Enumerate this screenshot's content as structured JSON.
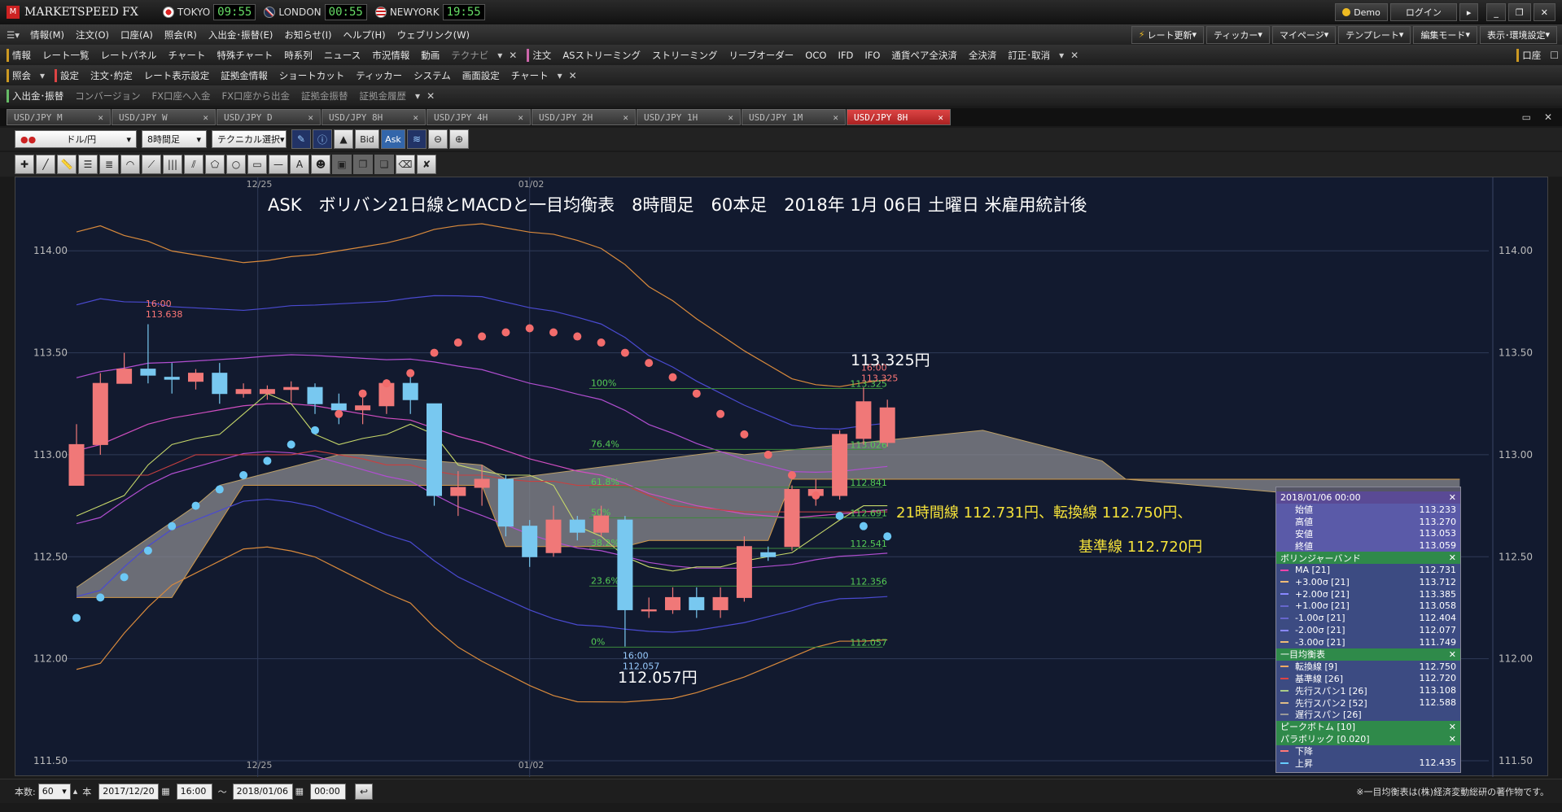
{
  "app": {
    "logo": "MARKETSPEED FX"
  },
  "clocks": [
    {
      "city": "TOKYO",
      "time": "09:55"
    },
    {
      "city": "LONDON",
      "time": "00:55"
    },
    {
      "city": "NEWYORK",
      "time": "19:55"
    }
  ],
  "titlebar": {
    "demo": "Demo",
    "login": "ログイン"
  },
  "menu": [
    "情報(M)",
    "注文(O)",
    "口座(A)",
    "照会(R)",
    "入出金･振替(E)",
    "お知らせ(I)",
    "ヘルプ(H)",
    "ウェブリンク(W)"
  ],
  "menu_right": [
    "レート更新",
    "ティッカー",
    "マイページ",
    "テンプレート",
    "編集モード",
    "表示･環境設定"
  ],
  "tb1": {
    "label1": "情報",
    "items1": [
      "レート一覧",
      "レートパネル",
      "チャート",
      "特殊チャート",
      "時系列",
      "ニュース",
      "市況情報",
      "動画",
      "テクナビ"
    ],
    "label2": "注文",
    "items2": [
      "ASストリーミング",
      "ストリーミング",
      "リーブオーダー",
      "OCO",
      "IFD",
      "IFO",
      "通貨ペア全決済",
      "全決済",
      "訂正･取消"
    ],
    "right": "口座"
  },
  "tb2": {
    "label1": "照会",
    "label2": "設定",
    "items": [
      "注文･約定",
      "レート表示設定",
      "証拠金情報",
      "ショートカット",
      "ティッカー",
      "システム",
      "画面設定",
      "チャート"
    ]
  },
  "tb3": {
    "label1": "入出金･振替",
    "items": [
      "コンバージョン",
      "FX口座へ入金",
      "FX口座から出金",
      "証拠金振替",
      "証拠金履歴"
    ]
  },
  "tabs": [
    "USD/JPY M",
    "USD/JPY W",
    "USD/JPY D",
    "USD/JPY 8H",
    "USD/JPY 4H",
    "USD/JPY 2H",
    "USD/JPY 1H",
    "USD/JPY 1M",
    "USD/JPY 8H"
  ],
  "controls": {
    "pair": "ドル/円",
    "period": "8時間足",
    "tech": "テクニカル選択",
    "bid": "Bid",
    "ask": "Ask"
  },
  "chart": {
    "title": "ASK　ボリバン21日線とMACDと一目均衡表　8時間足　60本足　2018年 1月 06日 土曜日 米雇用統計後",
    "high_label": "113.325円",
    "low_label": "112.057円",
    "note1": "21時間線 112.731円、転換線 112.750円、",
    "note2": "基準線 112.720円",
    "hi_marker": {
      "time": "16:00",
      "value": "113.638"
    },
    "hi2_marker": {
      "time": "16:00",
      "value": "113.325"
    },
    "lo_marker": {
      "time": "16:00",
      "value": "112.057"
    },
    "date_labels": [
      "12/25",
      "01/02"
    ],
    "fib": [
      {
        "label": "100%",
        "value": "113.325"
      },
      {
        "label": "76.4%",
        "value": "113.026"
      },
      {
        "label": "61.8%",
        "value": "112.841"
      },
      {
        "label": "50%",
        "value": "112.691"
      },
      {
        "label": "38.2%",
        "value": "112.541"
      },
      {
        "label": "23.6%",
        "value": "112.356"
      },
      {
        "label": "0%",
        "value": "112.057"
      }
    ]
  },
  "chart_data": {
    "type": "candlestick",
    "yticks": [
      "114.00",
      "113.50",
      "113.00",
      "112.50",
      "112.00",
      "111.50"
    ],
    "ylim": [
      111.42,
      114.36
    ],
    "candles": [
      [
        112.85,
        113.05,
        112.85,
        113.15
      ],
      [
        113.05,
        113.35,
        113.0,
        113.4
      ],
      [
        113.35,
        113.42,
        113.35,
        113.5
      ],
      [
        113.42,
        113.39,
        113.35,
        113.64
      ],
      [
        113.38,
        113.37,
        113.3,
        113.45
      ],
      [
        113.36,
        113.4,
        113.32,
        113.42
      ],
      [
        113.4,
        113.3,
        113.25,
        113.45
      ],
      [
        113.3,
        113.32,
        113.28,
        113.35
      ],
      [
        113.3,
        113.32,
        113.27,
        113.34
      ],
      [
        113.32,
        113.33,
        113.26,
        113.36
      ],
      [
        113.33,
        113.25,
        113.2,
        113.35
      ],
      [
        113.25,
        113.22,
        113.15,
        113.3
      ],
      [
        113.22,
        113.24,
        113.15,
        113.28
      ],
      [
        113.24,
        113.35,
        113.2,
        113.37
      ],
      [
        113.35,
        113.27,
        113.2,
        113.38
      ],
      [
        113.25,
        112.8,
        112.75,
        113.25
      ],
      [
        112.8,
        112.84,
        112.7,
        112.92
      ],
      [
        112.84,
        112.88,
        112.75,
        112.95
      ],
      [
        112.88,
        112.65,
        112.6,
        112.9
      ],
      [
        112.65,
        112.5,
        112.45,
        112.68
      ],
      [
        112.52,
        112.68,
        112.5,
        112.75
      ],
      [
        112.68,
        112.62,
        112.58,
        112.7
      ],
      [
        112.62,
        112.7,
        112.6,
        112.75
      ],
      [
        112.68,
        112.24,
        112.06,
        112.7
      ],
      [
        112.24,
        112.24,
        112.2,
        112.3
      ],
      [
        112.24,
        112.3,
        112.22,
        112.35
      ],
      [
        112.3,
        112.24,
        112.2,
        112.35
      ],
      [
        112.24,
        112.3,
        112.2,
        112.35
      ],
      [
        112.3,
        112.55,
        112.28,
        112.6
      ],
      [
        112.52,
        112.5,
        112.48,
        112.55
      ],
      [
        112.55,
        112.83,
        112.53,
        112.85
      ],
      [
        112.8,
        112.83,
        112.75,
        112.88
      ],
      [
        112.8,
        113.1,
        112.78,
        113.12
      ],
      [
        113.08,
        113.26,
        113.05,
        113.33
      ],
      [
        113.06,
        113.23,
        113.04,
        113.27
      ]
    ],
    "bb_mid": [
      113.02,
      113.05,
      113.1,
      113.15,
      113.18,
      113.2,
      113.22,
      113.24,
      113.25,
      113.25,
      113.24,
      113.22,
      113.2,
      113.18,
      113.17,
      113.13,
      113.09,
      113.06,
      113.02,
      112.98,
      112.95,
      112.92,
      112.9,
      112.86,
      112.81,
      112.78,
      112.75,
      112.73,
      112.71,
      112.7,
      112.69,
      112.7,
      112.71,
      112.72,
      112.73
    ],
    "parabolic": [
      112.2,
      112.3,
      112.4,
      112.53,
      112.65,
      112.75,
      112.83,
      112.9,
      112.97,
      113.05,
      113.12,
      113.2,
      113.3,
      113.35,
      113.4,
      113.5,
      113.55,
      113.58,
      113.6,
      113.62,
      113.6,
      113.58,
      113.55,
      113.5,
      113.45,
      113.38,
      113.3,
      113.2,
      113.1,
      113.0,
      112.9,
      112.8,
      112.7,
      112.65,
      112.6
    ],
    "legend": [
      {
        "section": "2018/01/06 00:00",
        "rows": [
          [
            "始値",
            "113.233"
          ],
          [
            "高値",
            "113.270"
          ],
          [
            "安値",
            "113.053"
          ],
          [
            "終値",
            "113.059"
          ]
        ]
      },
      {
        "section": "ボリンジャーバンド",
        "rows": [
          [
            "MA [21]",
            "112.731"
          ],
          [
            "+3.00σ [21]",
            "113.712"
          ],
          [
            "+2.00σ [21]",
            "113.385"
          ],
          [
            "+1.00σ [21]",
            "113.058"
          ],
          [
            "-1.00σ [21]",
            "112.404"
          ],
          [
            "-2.00σ [21]",
            "112.077"
          ],
          [
            "-3.00σ [21]",
            "111.749"
          ]
        ]
      },
      {
        "section": "一目均衡表",
        "rows": [
          [
            "転換線 [9]",
            "112.750"
          ],
          [
            "基準線 [26]",
            "112.720"
          ],
          [
            "先行スパン1 [26]",
            "113.108"
          ],
          [
            "先行スパン2 [52]",
            "112.588"
          ],
          [
            "遅行スパン [26]",
            ""
          ]
        ]
      },
      {
        "section": "ピークボトム [10]",
        "rows": []
      },
      {
        "section": "パラボリック [0.020]",
        "rows": [
          [
            "下降",
            ""
          ],
          [
            "上昇",
            "112.435"
          ]
        ]
      }
    ]
  },
  "bottom": {
    "count_label": "本数:",
    "count": "60",
    "unit": "本",
    "from_date": "2017/12/20",
    "from_time": "16:00",
    "tilde": "～",
    "to_date": "2018/01/06",
    "to_time": "00:00",
    "footnote": "※一目均衡表は(株)経済変動総研の著作物です。"
  }
}
